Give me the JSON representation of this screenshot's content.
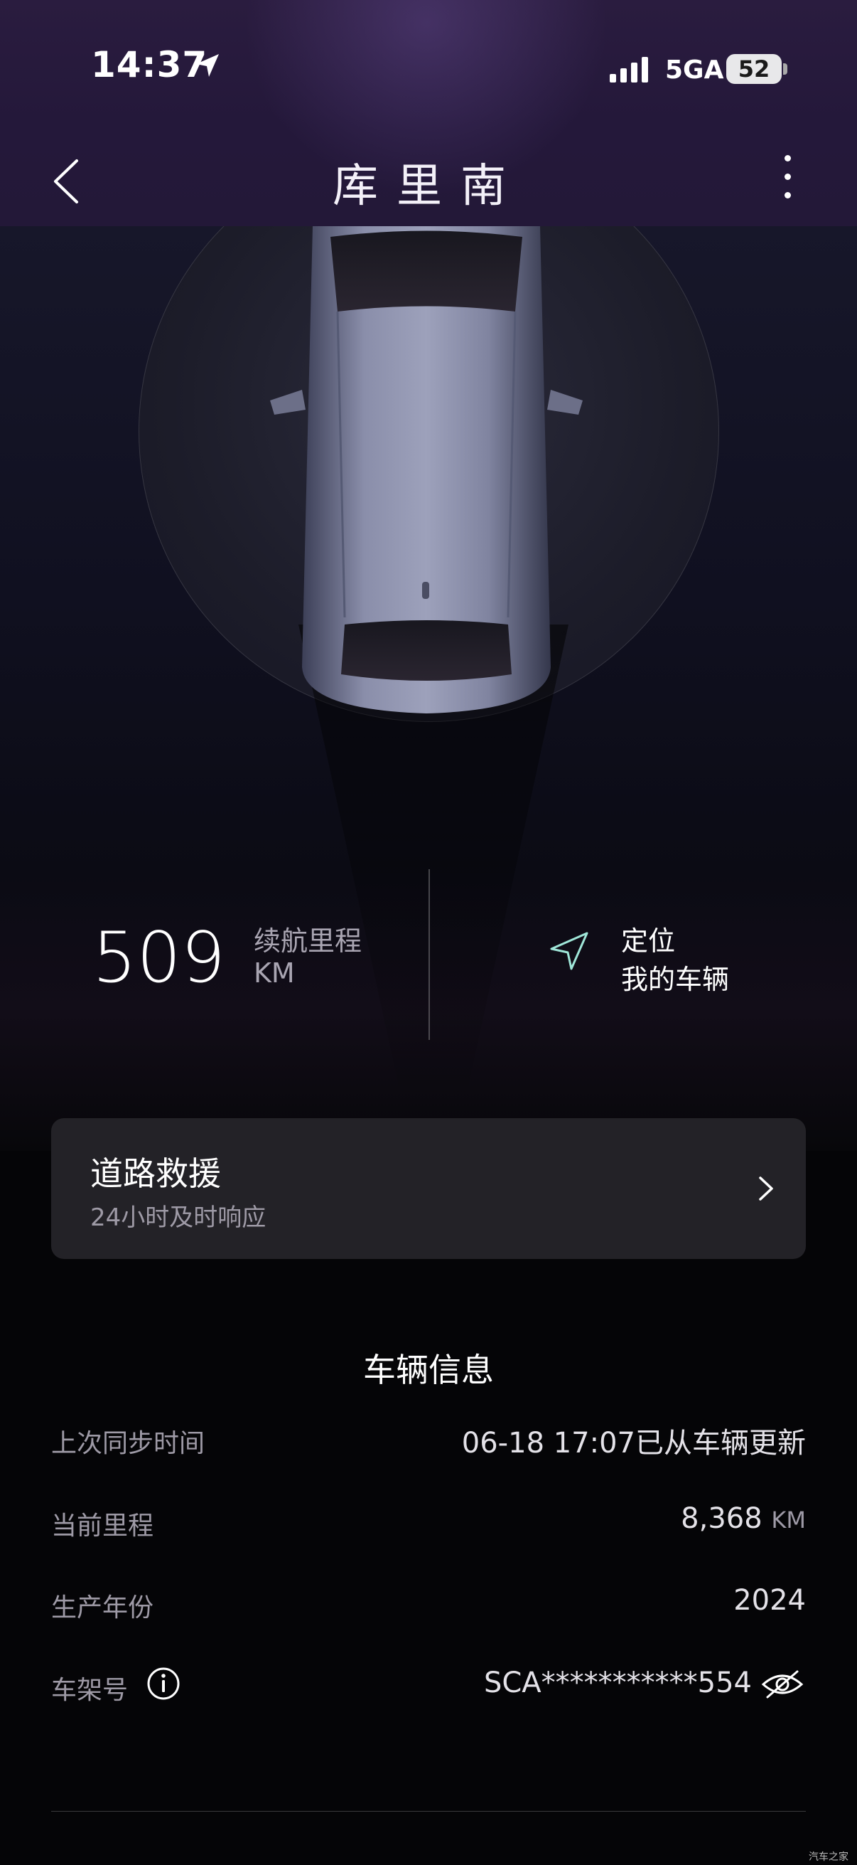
{
  "status_bar": {
    "time": "14:37",
    "network": "5GA",
    "battery": "52"
  },
  "header": {
    "title": "库里南"
  },
  "range": {
    "value": "509",
    "label": "续航里程",
    "unit": "KM"
  },
  "locate": {
    "line1": "定位",
    "line2": "我的车辆"
  },
  "roadside": {
    "title": "道路救援",
    "subtitle": "24小时及时响应"
  },
  "vehicle_info": {
    "title": "车辆信息",
    "rows": [
      {
        "label": "上次同步时间",
        "value": "06-18 17:07已从车辆更新"
      },
      {
        "label": "当前里程",
        "value": "8,368",
        "unit": "KM"
      },
      {
        "label": "生产年份",
        "value": "2024"
      },
      {
        "label": "车架号",
        "value": "SCA***********554"
      }
    ]
  },
  "watermark": "汽车之家"
}
